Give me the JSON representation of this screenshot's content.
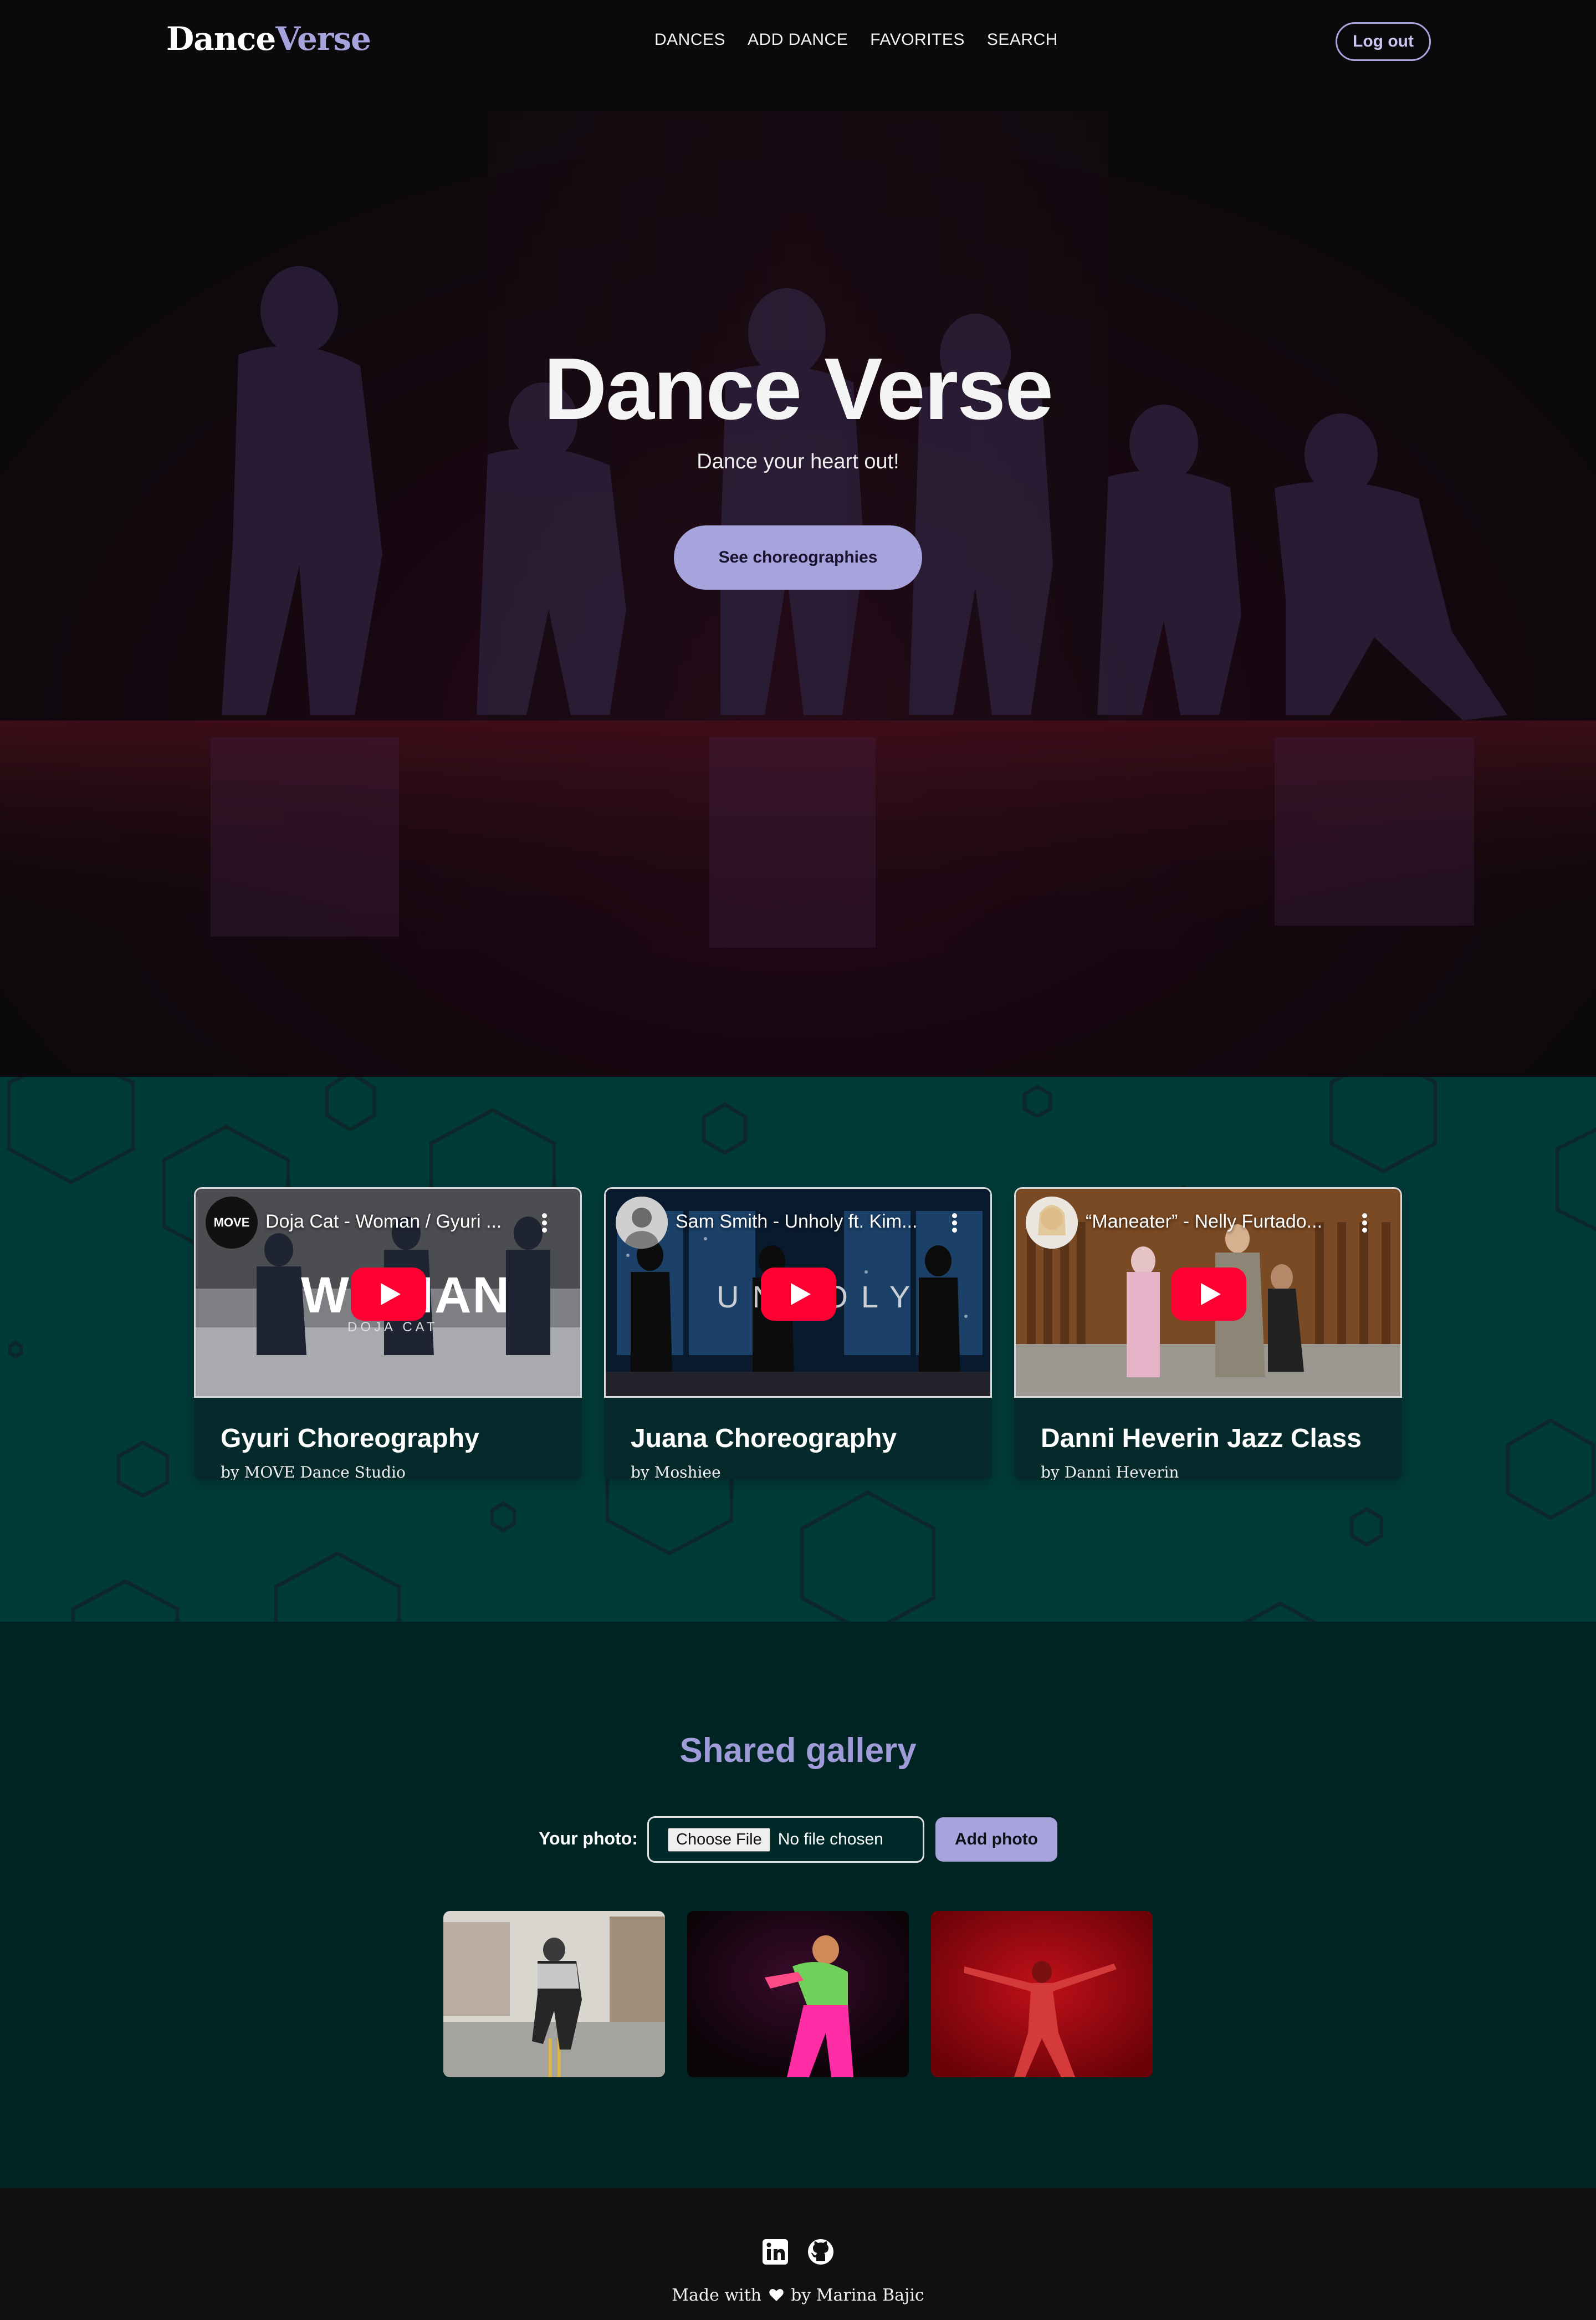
{
  "brand": {
    "part1": "Dance",
    "part2": "Verse"
  },
  "nav": {
    "items": [
      "DANCES",
      "ADD DANCE",
      "FAVORITES",
      "SEARCH"
    ],
    "logout": "Log out"
  },
  "hero": {
    "title": "Dance Verse",
    "subtitle": "Dance your heart out!",
    "cta": "See choreographies"
  },
  "dances": [
    {
      "video_title": "Doja Cat - Woman / Gyuri ...",
      "channel": "MOVE",
      "title": "Gyuri Choreography",
      "author": "by MOVE Dance Studio",
      "overlay_text": "WOMAN",
      "overlay_sub": "DOJA CAT"
    },
    {
      "video_title": "Sam Smith - Unholy ft. Kim...",
      "title": "Juana Choreography",
      "author": "by Moshiee",
      "overlay_text": "UNHOLY"
    },
    {
      "video_title": "“Maneater” - Nelly Furtado...",
      "title": "Danni Heverin Jazz Class",
      "author": "by Danni Heverin"
    }
  ],
  "gallery": {
    "title": "Shared gallery",
    "photo_label": "Your photo:",
    "file_button": "Choose File",
    "file_status": "No file chosen",
    "add_button": "Add photo"
  },
  "footer": {
    "made_prefix": "Made with",
    "made_suffix": "by Marina Bajic",
    "icons": [
      "linkedin-icon",
      "github-icon"
    ]
  },
  "colors": {
    "accent": "#a7a3dd",
    "teal": "#003b3a",
    "dark_teal": "#002424",
    "footer": "#121112",
    "youtube_red": "#ff0033"
  }
}
